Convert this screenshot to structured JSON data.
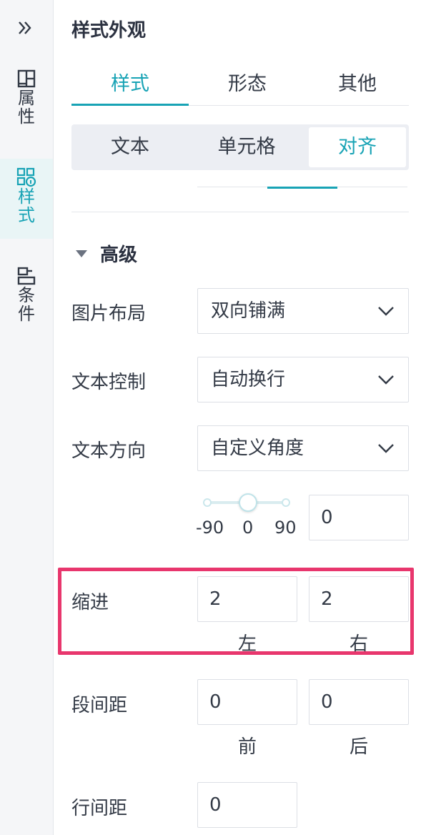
{
  "rail": {
    "collapse_icon": "double-chevron-right-icon",
    "items": [
      {
        "label": "属性",
        "icon": "layout-icon"
      },
      {
        "label": "样式",
        "icon": "style-icon"
      },
      {
        "label": "条件",
        "icon": "condition-icon"
      }
    ],
    "accent": "#18a3b5"
  },
  "panel": {
    "title": "样式外观",
    "tabs": [
      "样式",
      "形态",
      "其他"
    ],
    "segments": [
      "文本",
      "单元格",
      "对齐"
    ],
    "advanced": {
      "title": "高级",
      "image_layout": {
        "label": "图片布局",
        "value": "双向铺满"
      },
      "text_control": {
        "label": "文本控制",
        "value": "自动换行"
      },
      "text_direction": {
        "label": "文本方向",
        "value": "自定义角度"
      },
      "angle": {
        "min_label": "-90",
        "mid_label": "0",
        "max_label": "90",
        "value": "0"
      },
      "indent": {
        "label": "缩进",
        "left_value": "2",
        "right_value": "2",
        "left_label": "左",
        "right_label": "右"
      },
      "para_spacing": {
        "label": "段间距",
        "before_value": "0",
        "after_value": "0",
        "before_label": "前",
        "after_label": "后"
      },
      "line_spacing": {
        "label": "行间距",
        "value": "0"
      }
    },
    "highlight_color": "#e8366d"
  }
}
